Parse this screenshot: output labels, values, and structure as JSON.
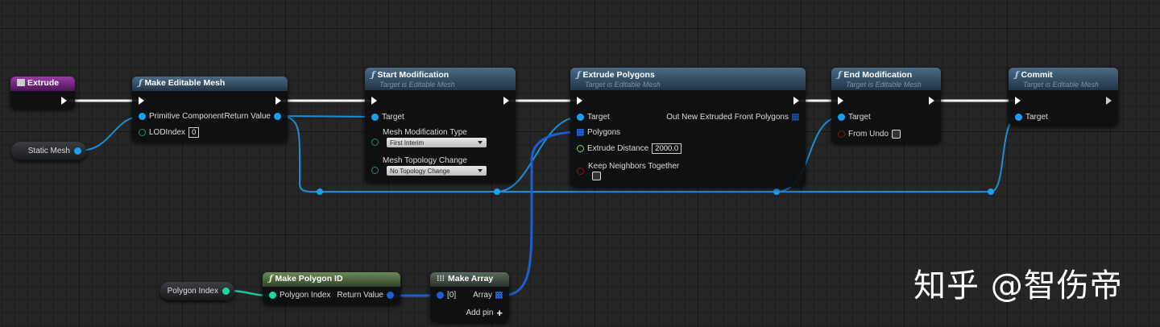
{
  "colors": {
    "exec": "#ffffff",
    "object_pin": "#1aa0f0",
    "struct_pin": "#1d5fd0",
    "int_pin": "#1fd6a0",
    "float_pin": "#8ed05a",
    "bool_pin": "#8a1515",
    "function_header": "#3d5a73",
    "event_header": "#7a2a8a",
    "pure_header": "#4d6b3c"
  },
  "nodes": {
    "extrude": {
      "title": "Extrude",
      "icon": "event-icon"
    },
    "static_mesh": {
      "label": "Static Mesh"
    },
    "make_editable_mesh": {
      "title": "Make Editable Mesh",
      "inputs": [
        "Primitive Component",
        "LODIndex"
      ],
      "lod_index": "0",
      "output": "Return Value"
    },
    "start_modification": {
      "title": "Start Modification",
      "subtitle": "Target is Editable Mesh",
      "target": "Target",
      "mod_type_label": "Mesh Modification Type",
      "mod_type_value": "First Interim",
      "topology_label": "Mesh Topology Change",
      "topology_value": "No Topology Change"
    },
    "extrude_polygons": {
      "title": "Extrude Polygons",
      "subtitle": "Target is Editable Mesh",
      "target": "Target",
      "polygons": "Polygons",
      "distance_label": "Extrude Distance",
      "distance_value": "2000.0",
      "keep_label": "Keep Neighbors Together",
      "keep_checked": false,
      "output": "Out New Extruded Front Polygons"
    },
    "end_modification": {
      "title": "End Modification",
      "subtitle": "Target is Editable Mesh",
      "target": "Target",
      "from_undo": "From Undo",
      "from_undo_checked": false
    },
    "commit": {
      "title": "Commit",
      "subtitle": "Target is Editable Mesh",
      "target": "Target"
    },
    "polygon_index": {
      "label": "Polygon Index"
    },
    "make_polygon_id": {
      "title": "Make Polygon ID",
      "input": "Polygon Index",
      "output": "Return Value"
    },
    "make_array": {
      "title": "Make Array",
      "input": "[0]",
      "output": "Array",
      "add_pin": "Add pin"
    }
  },
  "watermark": "知乎 @智伤帝"
}
